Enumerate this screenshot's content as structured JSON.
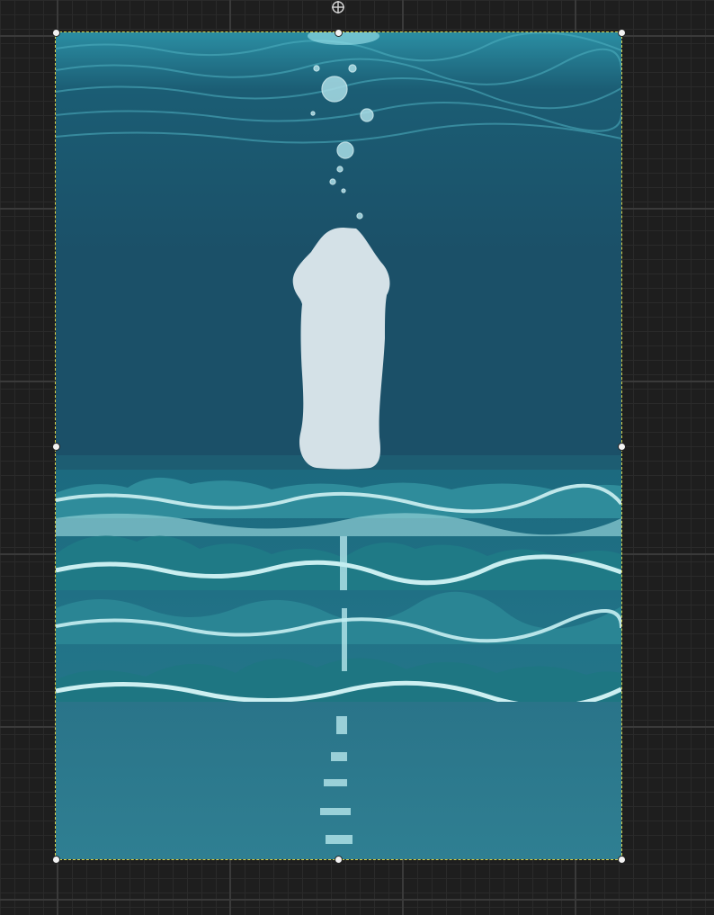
{
  "canvas": {
    "background_color": "#1e1e1e",
    "grid_major_color": "#3a3a3a",
    "grid_minor_color": "#2a2a2a"
  },
  "image_layer": {
    "content": "ocean-sunset-underwater-illustration",
    "palette": {
      "deep_water": "#1a4f66",
      "surface": "#2f7f94",
      "foam": "#cfeef0",
      "sand": "#2d7a8c",
      "brush_mask": "#d4e1e7"
    }
  },
  "selection": {
    "border_color": "#d8d24a",
    "handle_color": "#f2f2f2"
  },
  "icons": {
    "move": "move-icon"
  }
}
